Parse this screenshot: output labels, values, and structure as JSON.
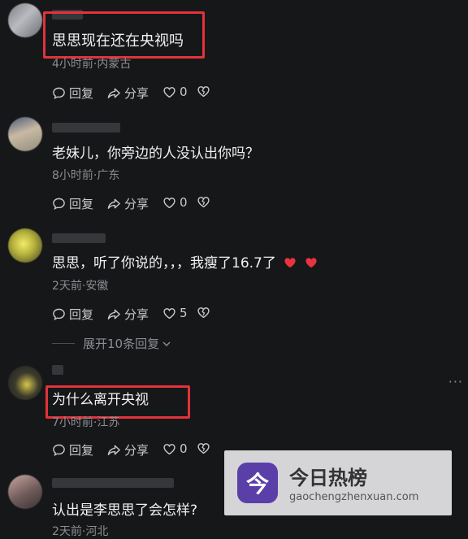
{
  "actions": {
    "reply": "回复",
    "share": "分享"
  },
  "comments": [
    {
      "text": "思思现在还在央视吗",
      "meta": "4小时前·内蒙古",
      "likes": "0",
      "highlighted": true
    },
    {
      "text": "老妹儿，你旁边的人没认出你吗？",
      "meta": "8小时前·广东",
      "likes": "0",
      "highlighted": false
    },
    {
      "text": "思思，听了你说的，，，我瘦了16.7了",
      "meta": "2天前·安徽",
      "likes": "5",
      "highlighted": false
    },
    {
      "text": "为什么离开央视",
      "meta": "7小时前·江苏",
      "likes": "0",
      "highlighted": true
    },
    {
      "text": "认出是李思思了会怎样?",
      "meta": "2天前·河北",
      "likes": "",
      "highlighted": false
    }
  ],
  "expand_replies": "展开10条回复",
  "more_menu": "···",
  "watermark": {
    "logo_char": "今",
    "title": "今日热榜",
    "subtitle": "gaochengzhenxuan.com"
  },
  "colors": {
    "background": "#161719",
    "highlight": "#e2323a",
    "heart": "#e8343f",
    "watermark_logo": "#5b3fa8"
  }
}
